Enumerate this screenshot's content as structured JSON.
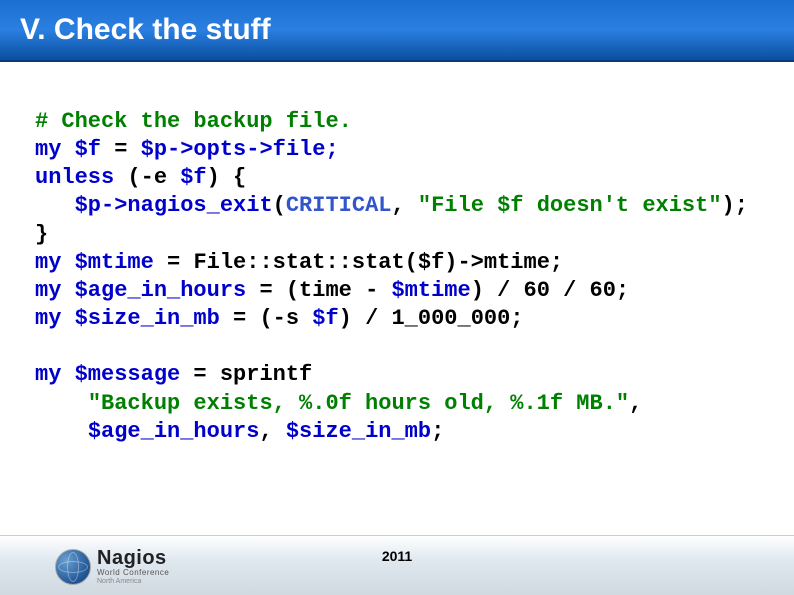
{
  "title": "V. Check the stuff",
  "footer_year": "2011",
  "logo": {
    "main": "Nagios",
    "sub": "World Conference",
    "sub2": "North America"
  },
  "code": {
    "l1_comment": "# Check the backup file.",
    "l2_my": "my",
    "l2_var": "$f",
    "l2_eq": " = ",
    "l2_rhs": "$p->opts->file;",
    "l3_kw": "unless",
    "l3_open": " (-e ",
    "l3_var": "$f",
    "l3_close": ") {",
    "l4_indent": "   ",
    "l4_call": "$p->nagios_exit",
    "l4_paren_open": "(",
    "l4_const": "CRITICAL",
    "l4_comma": ", ",
    "l4_str": "\"File $f doesn't exist\"",
    "l4_paren_close": ");",
    "l5_close": "}",
    "l6_my": "my",
    "l6_var": "$mtime",
    "l6_eq": " = ",
    "l6_rhs": "File::stat::stat($f)->mtime;",
    "l7_my": "my",
    "l7_var": "$age_in_hours",
    "l7_eq": " = (time - ",
    "l7_var2": "$mtime",
    "l7_rest": ") / 60 / 60;",
    "l8_my": "my",
    "l8_var": "$size_in_mb",
    "l8_eq": " = (-s ",
    "l8_var2": "$f",
    "l8_rest": ") / 1_000_000;",
    "l10_my": "my",
    "l10_var": "$message",
    "l10_eq": " = sprintf",
    "l11_indent": "    ",
    "l11_str": "\"Backup exists, %.0f hours old, %.1f MB.\"",
    "l11_comma": ",",
    "l12_indent": "    ",
    "l12_var1": "$age_in_hours",
    "l12_comma": ", ",
    "l12_var2": "$size_in_mb",
    "l12_semi": ";"
  }
}
